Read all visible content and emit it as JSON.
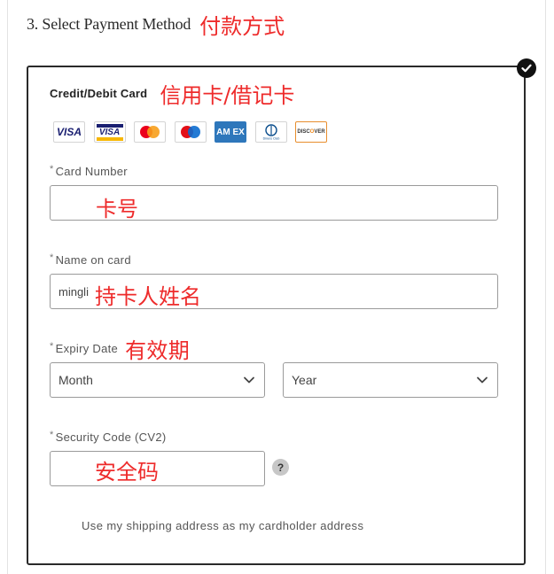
{
  "section": {
    "title": "3. Select Payment Method",
    "annotation": "付款方式"
  },
  "card": {
    "type_label": "Credit/Debit Card",
    "type_annotation": "信用卡/借记卡",
    "logos": {
      "visa": "VISA",
      "visa_electron": "VISA",
      "amex": "AM EX",
      "diners": "Diners Club",
      "discover_left": "DISC",
      "discover_o": "O",
      "discover_right": "VER"
    }
  },
  "fields": {
    "card_number": {
      "required_mark": "*",
      "label": "Card Number",
      "value": "",
      "annotation": "卡号"
    },
    "name_on_card": {
      "required_mark": "*",
      "label": "Name on card",
      "value": "mingli",
      "annotation": "持卡人姓名"
    },
    "expiry": {
      "required_mark": "*",
      "label": "Expiry Date",
      "annotation": "有效期",
      "month": {
        "selected": "Month"
      },
      "year": {
        "selected": "Year"
      }
    },
    "security_code": {
      "required_mark": "*",
      "label": "Security Code (CV2)",
      "value": "",
      "annotation": "安全码",
      "help": "?"
    }
  },
  "shipping_option": {
    "label": "Use my shipping address as my cardholder address"
  },
  "colors": {
    "annotation": "#ee2b2b",
    "border": "#9a9a9a",
    "panel_border": "#2a2a2a",
    "amex": "#2e77bb",
    "visa_blue": "#1a1f71",
    "discover_orange": "#f08a1c"
  }
}
